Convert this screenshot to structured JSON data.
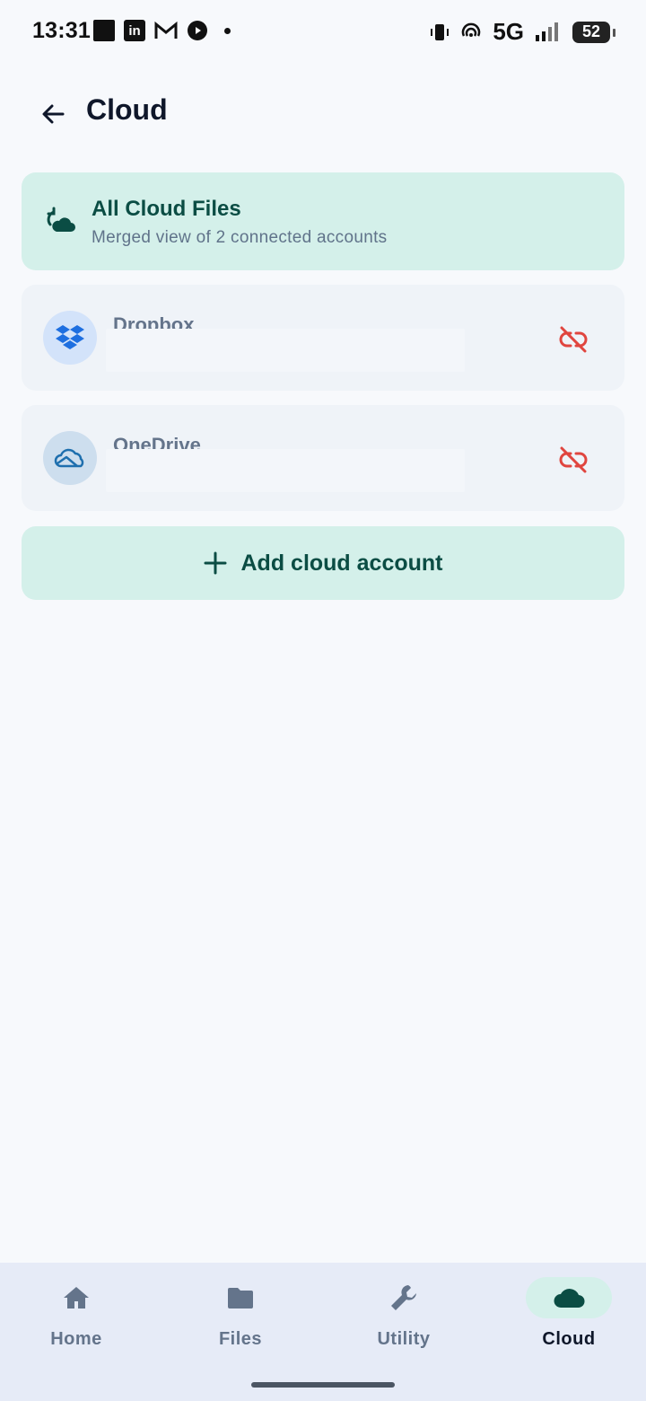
{
  "status_bar": {
    "time": "13:31",
    "network": "5G",
    "battery": "52"
  },
  "header": {
    "title": "Cloud"
  },
  "all_cloud": {
    "title": "All Cloud Files",
    "subtitle": "Merged view of 2 connected accounts"
  },
  "accounts": [
    {
      "name": "Dropbox",
      "icon": "dropbox-icon"
    },
    {
      "name": "OneDrive",
      "icon": "onedrive-icon"
    }
  ],
  "add_account": {
    "label": "Add cloud account"
  },
  "nav": [
    {
      "label": "Home",
      "icon": "home-icon"
    },
    {
      "label": "Files",
      "icon": "folder-icon"
    },
    {
      "label": "Utility",
      "icon": "wrench-icon"
    },
    {
      "label": "Cloud",
      "icon": "cloud-icon",
      "active": true
    }
  ],
  "colors": {
    "accent": "#0B4D44",
    "accent_bg": "#D4F0EA",
    "danger": "#E0453F",
    "nav_bg": "#E6EBF7"
  }
}
